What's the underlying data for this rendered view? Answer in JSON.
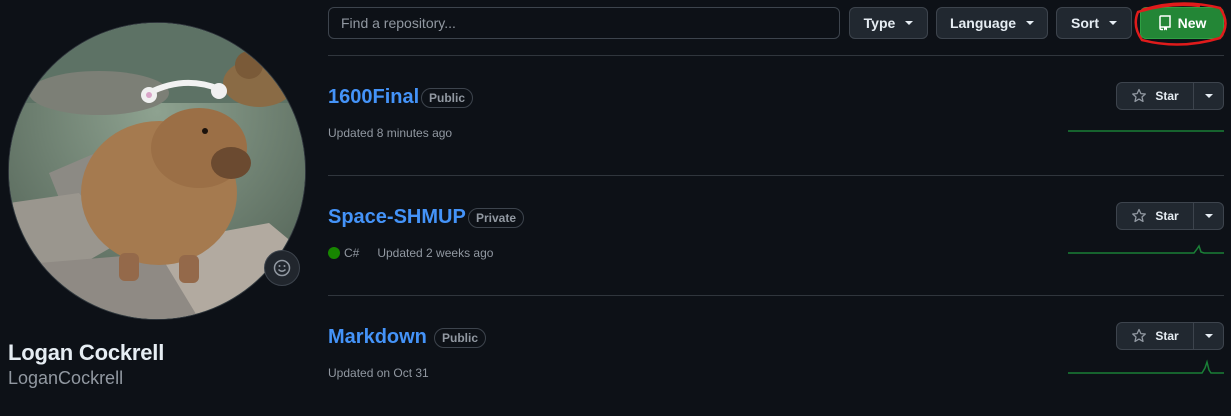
{
  "profile": {
    "name": "Logan Cockrell",
    "login": "LoganCockrell",
    "avatar_icon": "capybara-photo",
    "status_icon": "smiley-icon"
  },
  "toolbar": {
    "search_placeholder": "Find a repository...",
    "type_label": "Type",
    "language_label": "Language",
    "sort_label": "Sort",
    "new_label": "New",
    "new_color": "#238636"
  },
  "repos": [
    {
      "name": "1600Final",
      "visibility": "Public",
      "language": "",
      "updated": "Updated 8 minutes ago",
      "star_label": "Star"
    },
    {
      "name": "Space-SHMUP",
      "visibility": "Private",
      "language": "C#",
      "language_color": "#178600",
      "updated": "Updated 2 weeks ago",
      "star_label": "Star"
    },
    {
      "name": "Markdown",
      "visibility": "Public",
      "language": "",
      "updated": "Updated on Oct 31",
      "star_label": "Star"
    }
  ],
  "colors": {
    "background": "#0d1117",
    "link": "#4493f8",
    "muted": "#9198a1",
    "annotation": "#e01b1b"
  }
}
